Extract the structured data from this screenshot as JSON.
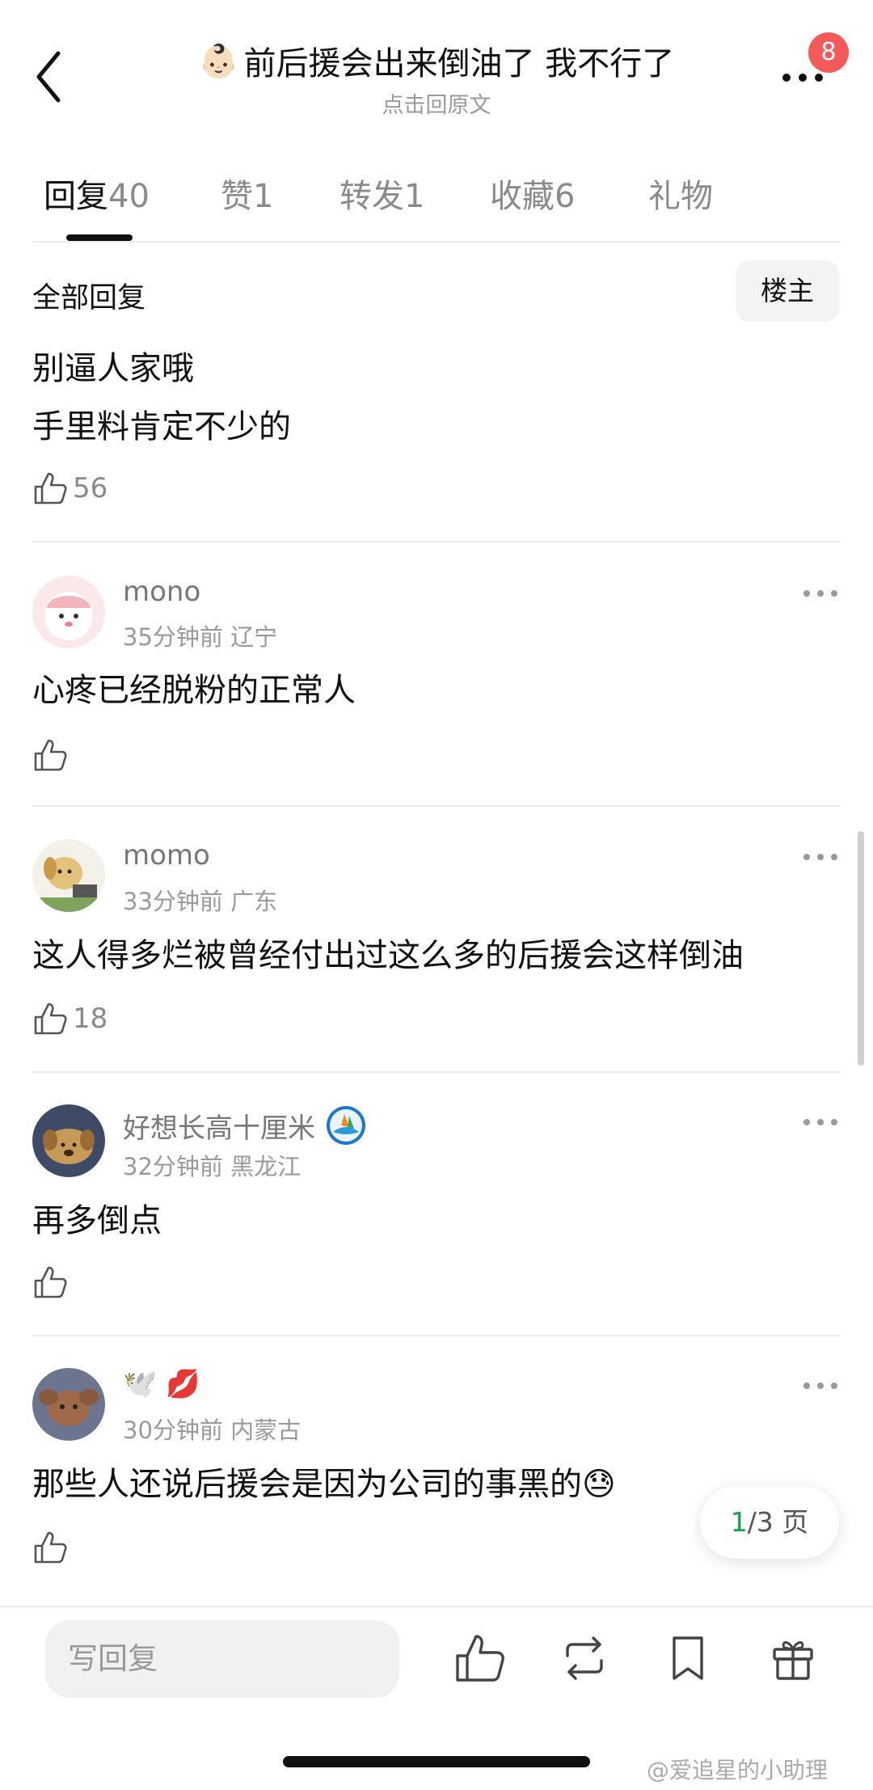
{
  "header": {
    "title_emoji": "👶🏻",
    "title": "前后援会出来倒油了 我不行了",
    "subtitle": "点击回原文",
    "notification_count": "8"
  },
  "tabs": [
    {
      "label": "回复",
      "count": "40",
      "active": true
    },
    {
      "label": "赞",
      "count": "1"
    },
    {
      "label": "转发",
      "count": "1"
    },
    {
      "label": "收藏",
      "count": "6"
    },
    {
      "label": "礼物",
      "count": ""
    }
  ],
  "section": {
    "title": "全部回复",
    "owner_filter": "楼主"
  },
  "top_comment": {
    "lines": [
      "别逼人家哦",
      "手里料肯定不少的"
    ],
    "likes": "56"
  },
  "comments": [
    {
      "user": "mono",
      "time": "35分钟前",
      "location": "辽宁",
      "text": "心疼已经脱粉的正常人",
      "likes": ""
    },
    {
      "user": "momo",
      "time": "33分钟前",
      "location": "广东",
      "text": "这人得多烂被曾经付出过这么多的后援会这样倒油",
      "likes": "18"
    },
    {
      "user": "好想长高十厘米",
      "time": "32分钟前",
      "location": "黑龙江",
      "text": "再多倒点",
      "likes": ""
    },
    {
      "user": "🕊️ 💋",
      "time": "30分钟前",
      "location": "内蒙古",
      "text": "那些人还说后援会是因为公司的事黑的😓",
      "likes": ""
    }
  ],
  "pagination": {
    "current": "1",
    "total_text": "/3 页"
  },
  "bottom_bar": {
    "reply_placeholder": "写回复"
  },
  "watermark": "@爱追星的小助理",
  "colors": {
    "accent_green": "#12a34a",
    "badge_red": "#f45a5a"
  }
}
